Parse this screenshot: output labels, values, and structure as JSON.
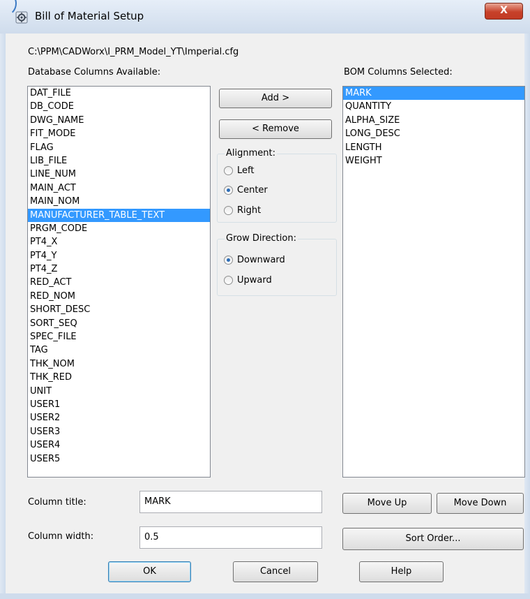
{
  "window": {
    "title": "Bill of Material Setup",
    "close_label": "X",
    "accent_color": "#3399ff"
  },
  "config_path": "C:\\PPM\\CADWorx\\I_PRM_Model_YT\\Imperial.cfg",
  "available": {
    "label": "Database Columns Available:",
    "items": [
      "DAT_FILE",
      "DB_CODE",
      "DWG_NAME",
      "FIT_MODE",
      "FLAG",
      "LIB_FILE",
      "LINE_NUM",
      "MAIN_ACT",
      "MAIN_NOM",
      "MANUFACTURER_TABLE_TEXT",
      "PRGM_CODE",
      "PT4_X",
      "PT4_Y",
      "PT4_Z",
      "RED_ACT",
      "RED_NOM",
      "SHORT_DESC",
      "SORT_SEQ",
      "SPEC_FILE",
      "TAG",
      "THK_NOM",
      "THK_RED",
      "UNIT",
      "USER1",
      "USER2",
      "USER3",
      "USER4",
      "USER5"
    ],
    "selected_item": "MANUFACTURER_TABLE_TEXT"
  },
  "selected_columns": {
    "label": "BOM Columns Selected:",
    "items": [
      "MARK",
      "QUANTITY",
      "ALPHA_SIZE",
      "LONG_DESC",
      "LENGTH",
      "WEIGHT"
    ],
    "selected_item": "MARK"
  },
  "buttons": {
    "add": "Add >",
    "remove": "< Remove",
    "move_up": "Move Up",
    "move_down": "Move Down",
    "sort_order": "Sort Order...",
    "ok": "OK",
    "cancel": "Cancel",
    "help": "Help"
  },
  "alignment": {
    "title": "Alignment:",
    "options": [
      "Left",
      "Center",
      "Right"
    ],
    "selected": "Center"
  },
  "grow_direction": {
    "title": "Grow Direction:",
    "options": [
      "Downward",
      "Upward"
    ],
    "selected": "Downward"
  },
  "fields": {
    "column_title_label": "Column title:",
    "column_title_value": "MARK",
    "column_width_label": "Column width:",
    "column_width_value": "0.5"
  }
}
